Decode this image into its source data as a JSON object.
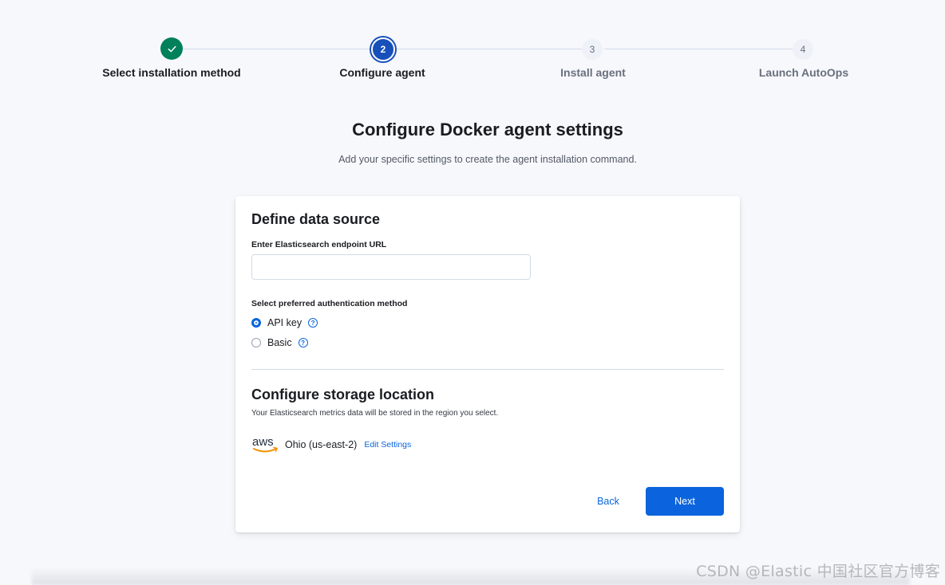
{
  "stepper": {
    "steps": [
      {
        "number": "",
        "label": "Select installation method",
        "state": "complete"
      },
      {
        "number": "2",
        "label": "Configure agent",
        "state": "current"
      },
      {
        "number": "3",
        "label": "Install agent",
        "state": "incomplete"
      },
      {
        "number": "4",
        "label": "Launch AutoOps",
        "state": "incomplete"
      }
    ],
    "check_icon": "check-icon"
  },
  "header": {
    "title": "Configure Docker agent settings",
    "subtitle": "Add your specific settings to create the agent installation command."
  },
  "data_source": {
    "heading": "Define data source",
    "endpoint_label": "Enter Elasticsearch endpoint URL",
    "endpoint_value": "",
    "auth_label": "Select preferred authentication method",
    "auth_options": [
      {
        "label": "API key",
        "selected": true
      },
      {
        "label": "Basic",
        "selected": false
      }
    ]
  },
  "storage": {
    "heading": "Configure storage location",
    "description": "Your Elasticsearch metrics data will be stored in the region you select.",
    "provider_logo": "aws",
    "region": "Ohio (us-east-2)",
    "edit_label": "Edit Settings"
  },
  "actions": {
    "back_label": "Back",
    "next_label": "Next"
  },
  "watermark": "CSDN @Elastic 中国社区官方博客",
  "colors": {
    "primary": "#0b64dd",
    "success": "#00805b",
    "current_step": "#1750ba"
  }
}
